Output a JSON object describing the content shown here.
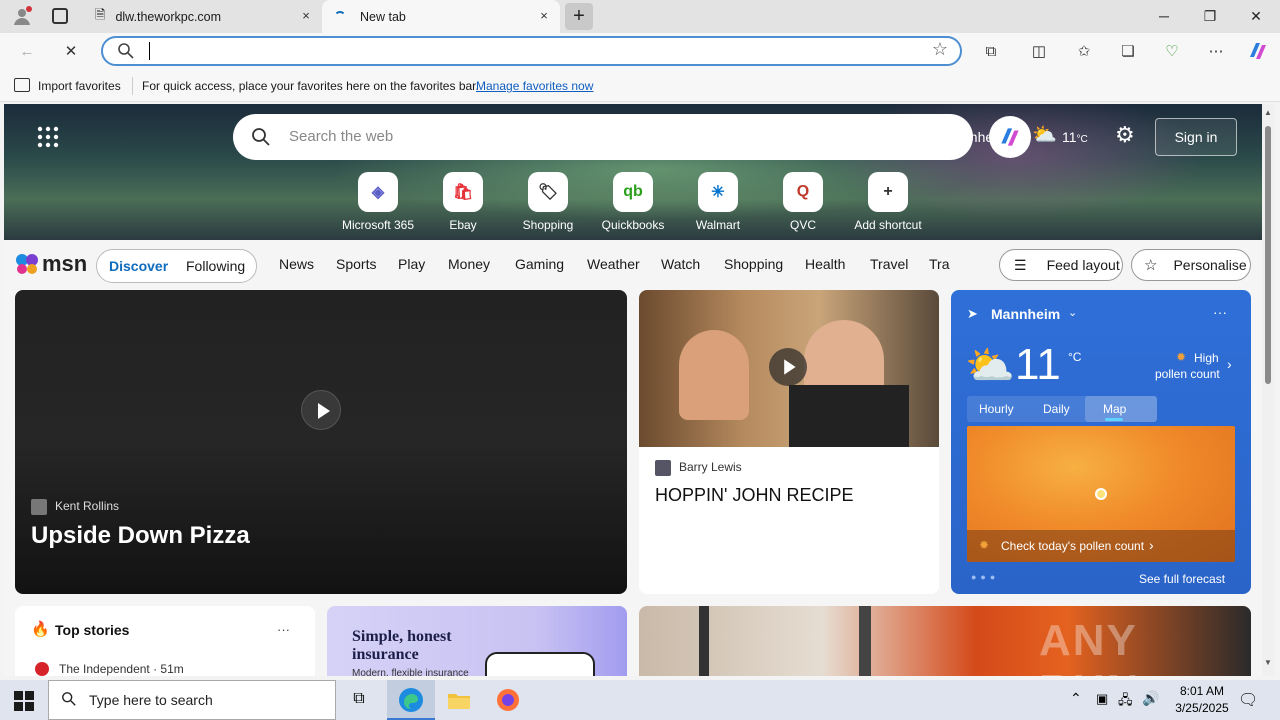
{
  "tabs": [
    {
      "title": "dlw.theworkpc.com",
      "close": "×"
    },
    {
      "title": "New tab",
      "close": "×"
    }
  ],
  "new_tab_symbol": "+",
  "window_controls": {
    "minimize": "─",
    "restore": "❐",
    "close": "✕"
  },
  "toolbar": {
    "address_value": ""
  },
  "favbar": {
    "import_label": "Import favorites",
    "message": "For quick access, place your favorites here on the favorites bar.",
    "manage_link": "Manage favorites now"
  },
  "hero": {
    "search_placeholder": "Search the web",
    "location_partial": "nnheim",
    "temperature": "11",
    "temp_unit": "°C",
    "sign_in": "Sign in",
    "shortcuts": [
      {
        "label": "Microsoft 365",
        "icon": "microsoft365-icon",
        "glyph": "◈",
        "color": "#5b5fc7"
      },
      {
        "label": "Ebay",
        "icon": "ebay-icon",
        "glyph": "🛍",
        "color": "#e53238"
      },
      {
        "label": "Shopping",
        "icon": "shopping-tag-icon",
        "glyph": "🏷",
        "color": "#333333"
      },
      {
        "label": "Quickbooks",
        "icon": "quickbooks-icon",
        "glyph": "qb",
        "color": "#2ca01c"
      },
      {
        "label": "Walmart",
        "icon": "walmart-icon",
        "glyph": "✳",
        "color": "#0071ce"
      },
      {
        "label": "QVC",
        "icon": "qvc-icon",
        "glyph": "Q",
        "color": "#c0392b"
      },
      {
        "label": "Add shortcut",
        "icon": "plus-icon",
        "glyph": "+",
        "color": "#333333"
      }
    ]
  },
  "msn": {
    "logo": "msn",
    "discover": "Discover",
    "following": "Following",
    "nav": [
      "News",
      "Sports",
      "Play",
      "Money",
      "Gaming",
      "Weather",
      "Watch",
      "Shopping",
      "Health",
      "Travel",
      "Tra"
    ],
    "feed_layout": "Feed layout",
    "personalise": "Personalise"
  },
  "cards": {
    "video_main": {
      "source": "Kent Rollins",
      "title": "Upside Down Pizza"
    },
    "video_two": {
      "source": "Barry Lewis",
      "title": "HOPPIN' JOHN RECIPE"
    },
    "weather": {
      "city": "Mannheim",
      "temp": "11",
      "unit": "°C",
      "pollen_line1": "High",
      "pollen_line2": "pollen count",
      "tabs": [
        "Hourly",
        "Daily",
        "Map"
      ],
      "map_banner": "Check today's pollen count",
      "see_full": "See full forecast",
      "more": "···"
    },
    "top_stories": {
      "title": "Top stories",
      "more": "···",
      "source": "The Independent · 51m"
    },
    "ad": {
      "headline_line1": "Simple, honest",
      "headline_line2": "insurance",
      "sub": "Modern, flexible insurance"
    }
  },
  "watermark": "ANY RUN",
  "taskbar": {
    "search_placeholder": "Type here to search",
    "time": "8:01 AM",
    "date": "3/25/2025"
  },
  "colors": {
    "accent": "#0f6cbd",
    "weather_bg": "#2a6bd4",
    "map_orange": "#f08a2a"
  }
}
